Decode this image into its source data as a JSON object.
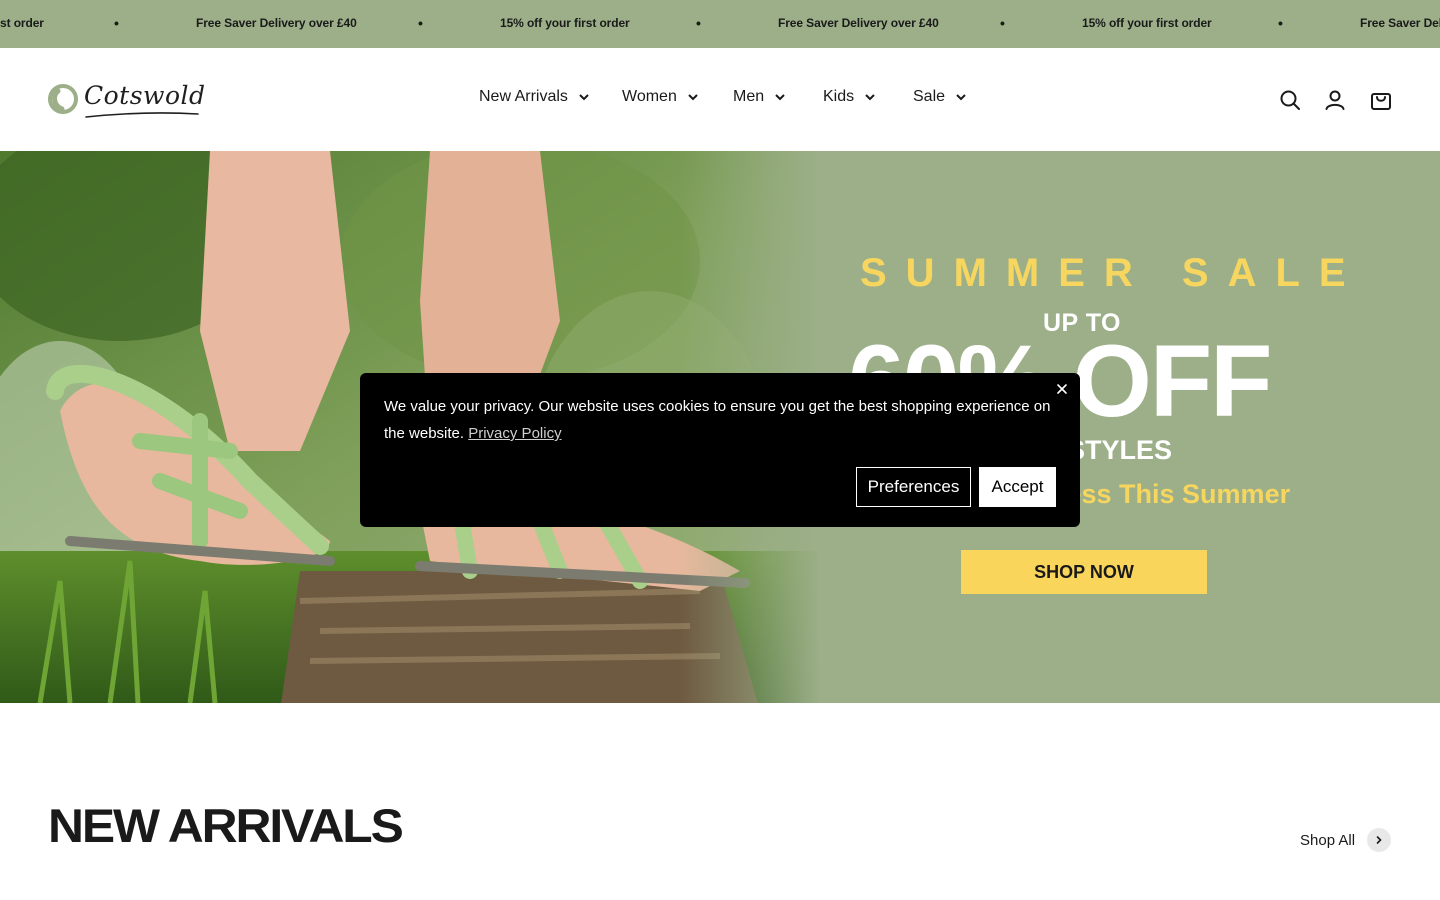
{
  "announcement": {
    "items": [
      "st order",
      "Free Saver Delivery over £40",
      "15% off your first order",
      "Free Saver Delivery over £40",
      "15% off your first order",
      "Free Saver Deliv"
    ],
    "separator": "•",
    "background": "#9caf88"
  },
  "header": {
    "logo_text": "Cotswold",
    "nav": [
      {
        "label": "New Arrivals"
      },
      {
        "label": "Women"
      },
      {
        "label": "Men"
      },
      {
        "label": "Kids"
      },
      {
        "label": "Sale"
      }
    ],
    "icons": [
      "search-icon",
      "account-icon",
      "cart-icon"
    ]
  },
  "hero": {
    "title": "SUMMER SALE",
    "upto": "UP TO",
    "percent": "60% OFF",
    "styles": "D STYLES",
    "tagline": "Less This Summer",
    "cta": "SHOP NOW",
    "accent": "#f7d660"
  },
  "cookie": {
    "text": "We value your privacy. Our website uses cookies to ensure you get the best shopping experience on the website.",
    "link": "Privacy Policy",
    "preferences": "Preferences",
    "accept": "Accept",
    "close_icon": "close-icon"
  },
  "new_arrivals": {
    "title": "NEW ARRIVALS",
    "shop_all": "Shop All"
  }
}
